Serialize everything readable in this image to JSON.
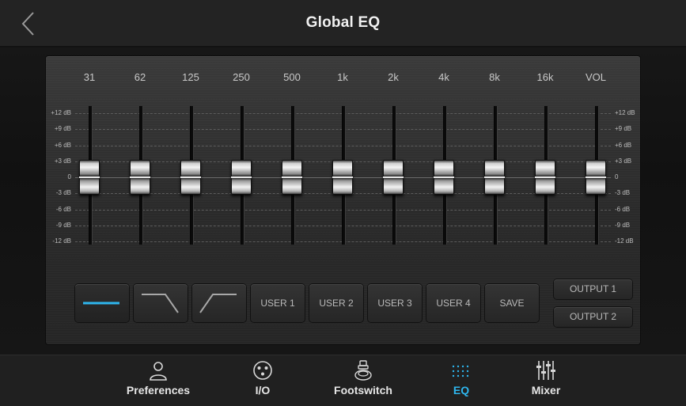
{
  "header": {
    "title": "Global EQ"
  },
  "eq": {
    "bands": [
      {
        "label": "31",
        "gain_db": 0
      },
      {
        "label": "62",
        "gain_db": 0
      },
      {
        "label": "125",
        "gain_db": 0
      },
      {
        "label": "250",
        "gain_db": 0
      },
      {
        "label": "500",
        "gain_db": 0
      },
      {
        "label": "1k",
        "gain_db": 0
      },
      {
        "label": "2k",
        "gain_db": 0
      },
      {
        "label": "4k",
        "gain_db": 0
      },
      {
        "label": "8k",
        "gain_db": 0
      },
      {
        "label": "16k",
        "gain_db": 0
      },
      {
        "label": "VOL",
        "gain_db": 0
      }
    ],
    "db_scale": [
      "+12 dB",
      "+9 dB",
      "+6 dB",
      "+3 dB",
      "0",
      "-3 dB",
      "-6 dB",
      "-9 dB",
      "-12 dB"
    ]
  },
  "presets": {
    "buttons": [
      {
        "label": "",
        "icon": "flat-curve-icon",
        "selected": true
      },
      {
        "label": "",
        "icon": "low-pass-curve-icon",
        "selected": false
      },
      {
        "label": "",
        "icon": "high-pass-curve-icon",
        "selected": false
      },
      {
        "label": "USER 1",
        "selected": false
      },
      {
        "label": "USER 2",
        "selected": false
      },
      {
        "label": "USER 3",
        "selected": false
      },
      {
        "label": "USER 4",
        "selected": false
      },
      {
        "label": "SAVE",
        "selected": false
      }
    ]
  },
  "outputs": {
    "output1_label": "OUTPUT 1",
    "output2_label": "OUTPUT 2"
  },
  "nav": {
    "items": [
      {
        "label": "Preferences",
        "icon": "person-icon"
      },
      {
        "label": "I/O",
        "icon": "xlr-connector-icon"
      },
      {
        "label": "Footswitch",
        "icon": "footswitch-icon"
      },
      {
        "label": "EQ",
        "icon": "eq-dots-icon",
        "active": true
      },
      {
        "label": "Mixer",
        "icon": "mixer-sliders-icon"
      }
    ]
  },
  "colors": {
    "accent": "#2eb6ee",
    "background": "#1b1b1b",
    "panel": "#2e2e2e"
  }
}
